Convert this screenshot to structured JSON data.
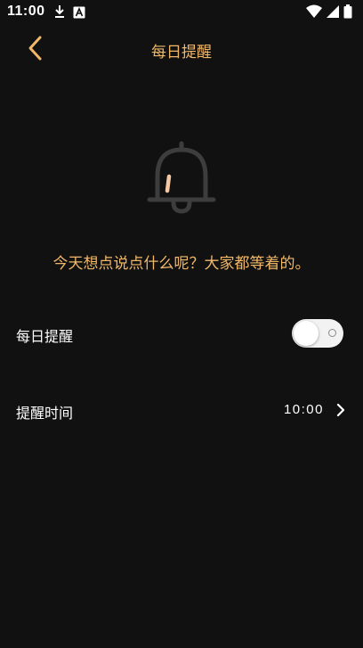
{
  "status_bar": {
    "time": "11:00",
    "left_icons": [
      "download-icon",
      "font-a-icon"
    ],
    "right_icons": [
      "wifi-icon",
      "cellular-icon",
      "battery-icon"
    ]
  },
  "header": {
    "title": "每日提醒",
    "back_icon": "chevron-left-icon"
  },
  "empty_state": {
    "icon": "bell-icon",
    "message": "今天想点说点什么呢？大家都等着的。"
  },
  "settings": {
    "daily_reminder": {
      "label": "每日提醒",
      "enabled": false
    },
    "reminder_time": {
      "label": "提醒时间",
      "value": "10:00"
    }
  },
  "colors": {
    "accent": "#f0b868",
    "background": "#111111",
    "text": "#ffffff",
    "icon_gray": "#3d3d3d"
  }
}
